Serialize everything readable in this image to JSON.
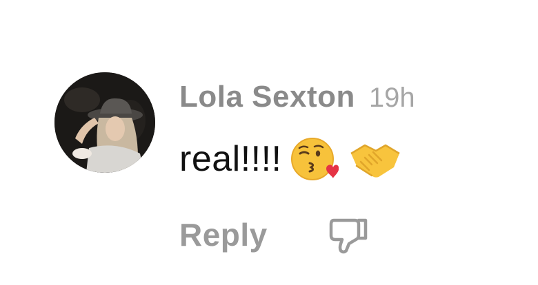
{
  "comment": {
    "author": "Lola Sexton",
    "timestamp": "19h",
    "text": "real!!!!",
    "emojis": [
      "kissing-face-with-heart-emoji",
      "handshake-emoji"
    ],
    "reply_label": "Reply",
    "dislike_icon": "thumbs-down-icon"
  },
  "colors": {
    "author": "#8a8a8a",
    "timestamp": "#a6a6a6",
    "text": "#111111",
    "action": "#9a9a9a",
    "background": "#ffffff"
  }
}
